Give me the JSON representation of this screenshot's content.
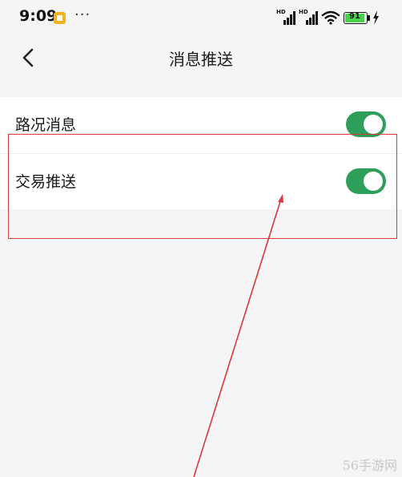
{
  "status_bar": {
    "time": "9:09",
    "more": "···",
    "signal_1_label": "HD",
    "signal_2_label": "HD",
    "battery_level": "91",
    "icons": [
      "notification-icon",
      "signal-icon",
      "wifi-icon",
      "battery-icon",
      "charging-bolt-icon"
    ]
  },
  "nav": {
    "title": "消息推送",
    "back_icon": "chevron-left-icon"
  },
  "settings": {
    "items": [
      {
        "label": "路况消息",
        "enabled": true
      },
      {
        "label": "交易推送",
        "enabled": true
      }
    ]
  },
  "colors": {
    "toggle_on": "#2e9e5b",
    "annotation": "#d9393b",
    "background": "#f5f5f5"
  },
  "watermark": "56手游网"
}
